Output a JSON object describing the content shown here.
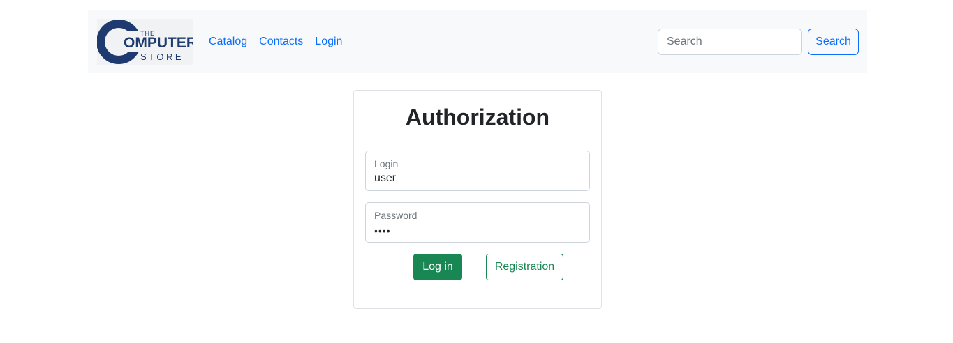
{
  "brand": {
    "logo_top": "THE",
    "logo_main": "OMPUTER",
    "logo_bottom": "STORE",
    "logo_color": "#1e3a6e"
  },
  "nav": {
    "links": [
      "Catalog",
      "Contacts",
      "Login"
    ]
  },
  "search": {
    "placeholder": "Search",
    "button_label": "Search"
  },
  "auth": {
    "title": "Authorization",
    "login_label": "Login",
    "login_value": "user",
    "password_label": "Password",
    "password_value": "••••",
    "login_button": "Log in",
    "register_button": "Registration"
  },
  "colors": {
    "link": "#0d6efd",
    "success": "#198754",
    "navbar_bg": "#f8f9fa"
  }
}
